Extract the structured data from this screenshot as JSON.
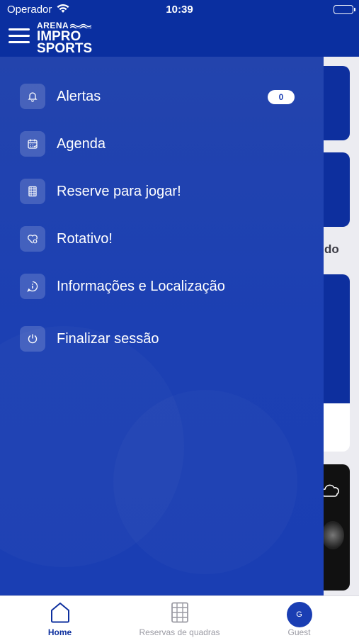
{
  "status_bar": {
    "carrier": "Operador",
    "time": "10:39"
  },
  "header": {
    "logo": {
      "line1": "ARENA",
      "line2": "IMPRO",
      "line3": "SPORTS"
    }
  },
  "background": {
    "partial_text": "do"
  },
  "drawer": {
    "items": [
      {
        "label": "Alertas",
        "icon": "bell-icon",
        "badge": "0"
      },
      {
        "label": "Agenda",
        "icon": "calendar-icon"
      },
      {
        "label": "Reserve para jogar!",
        "icon": "court-icon"
      },
      {
        "label": "Rotativo!",
        "icon": "heart-icon"
      },
      {
        "label": "Informações e Localização",
        "icon": "info-icon"
      },
      {
        "label": "Finalizar sessão",
        "icon": "power-icon"
      }
    ]
  },
  "tabbar": {
    "tabs": [
      {
        "label": "Home",
        "icon": "home-icon",
        "active": true
      },
      {
        "label": "Reservas de quadras",
        "icon": "court-icon",
        "active": false
      },
      {
        "label": "Guest",
        "icon": "avatar",
        "initial": "G",
        "active": false
      }
    ]
  },
  "colors": {
    "primary": "#0a2fa0",
    "drawer": "#1c40b3",
    "tab_active": "#0d2f9e",
    "tab_inactive": "#9a9aa3"
  }
}
